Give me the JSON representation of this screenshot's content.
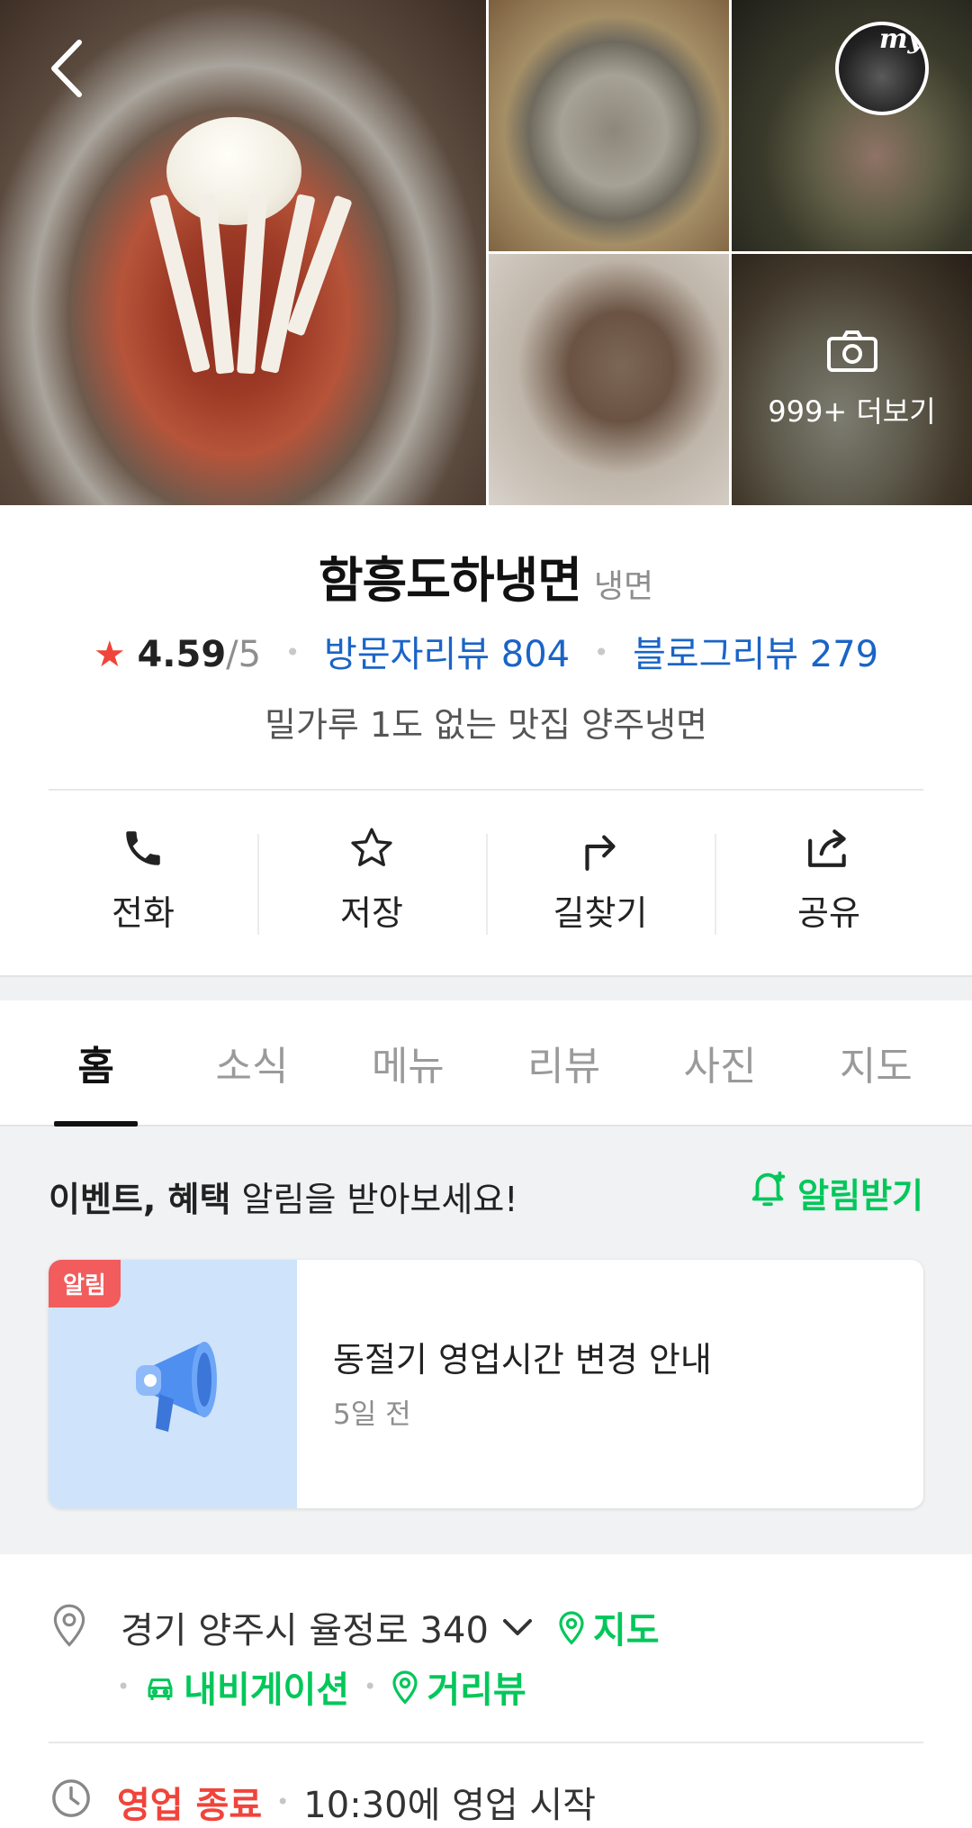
{
  "gallery": {
    "more_photos_label": "999+ 더보기",
    "profile_badge_text": "my"
  },
  "place": {
    "name": "함흥도하냉면",
    "category": "냉면",
    "rating_star": "★",
    "rating": "4.59",
    "rating_max": "/5",
    "visitor_reviews_label": "방문자리뷰 804",
    "blog_reviews_label": "블로그리뷰 279",
    "tagline": "밀가루 1도 없는 맛집 양주냉면"
  },
  "actions": [
    {
      "label": "전화",
      "icon": "phone-icon"
    },
    {
      "label": "저장",
      "icon": "star-icon"
    },
    {
      "label": "길찾기",
      "icon": "directions-icon"
    },
    {
      "label": "공유",
      "icon": "share-icon"
    }
  ],
  "tabs": [
    "홈",
    "소식",
    "메뉴",
    "리뷰",
    "사진",
    "지도"
  ],
  "active_tab": "홈",
  "notice": {
    "heading_bold": "이벤트, 혜택",
    "heading_rest": " 알림을 받아보세요!",
    "subscribe_label": "알림받기",
    "badge": "알림",
    "card_title": "동절기 영업시간 변경 안내",
    "card_time": "5일 전"
  },
  "info": {
    "address": "경기 양주시 율정로 340",
    "map_label": "지도",
    "navigation_label": "내비게이션",
    "street_view_label": "거리뷰",
    "status": "영업 종료",
    "next_open": "10:30에 영업 시작"
  },
  "colors": {
    "brand_green": "#03c75a",
    "link_blue": "#1a64c7",
    "closed_red": "#f0443b",
    "badge_red": "#f25c5c",
    "card_thumb_blue": "#cfe3fb"
  }
}
